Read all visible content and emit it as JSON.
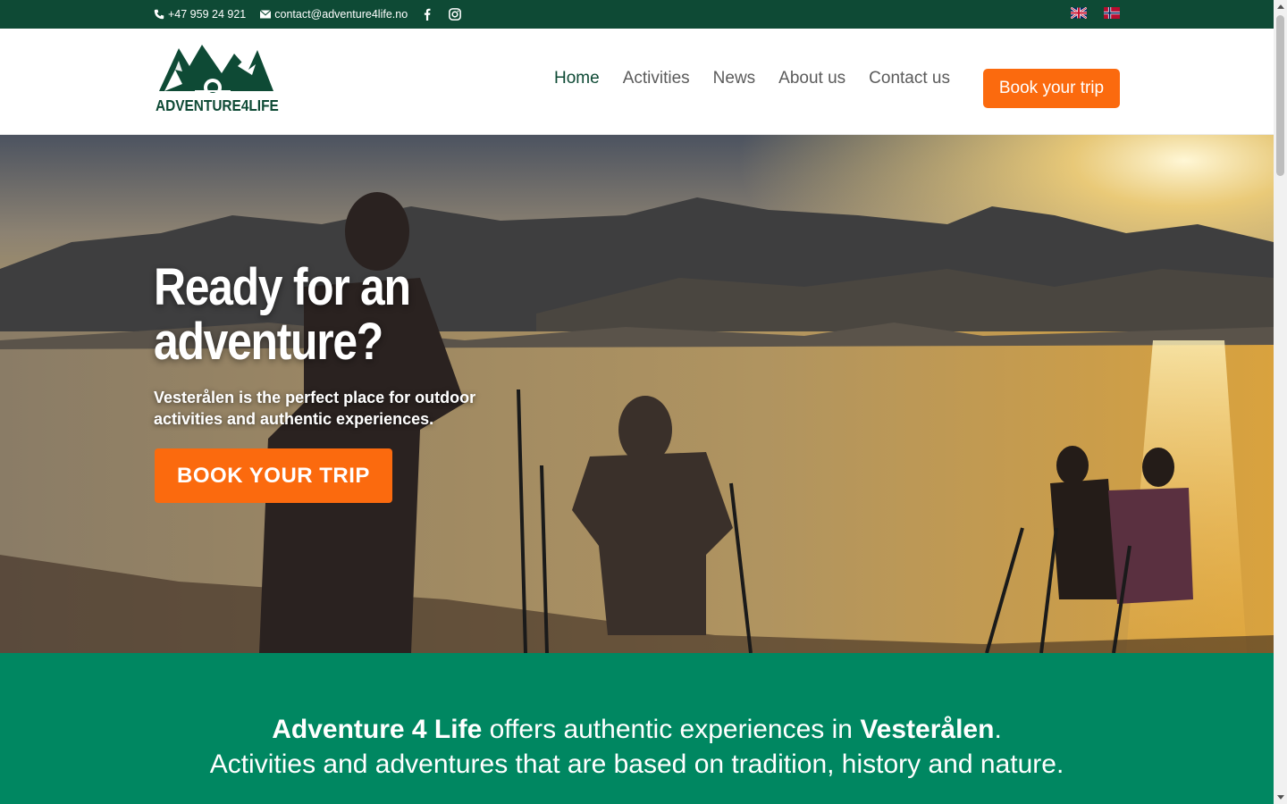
{
  "topbar": {
    "phone": "+47 959 24 921",
    "email": "contact@adventure4life.no",
    "social": [
      "facebook-icon",
      "instagram-icon"
    ],
    "languages": [
      "english-flag",
      "norwegian-flag"
    ]
  },
  "header": {
    "logo_text": "ADVENTURE4LIFE",
    "nav": [
      {
        "label": "Home",
        "active": true
      },
      {
        "label": "Activities",
        "active": false
      },
      {
        "label": "News",
        "active": false
      },
      {
        "label": "About us",
        "active": false
      },
      {
        "label": "Contact us",
        "active": false
      }
    ],
    "book_label": "Book your trip"
  },
  "hero": {
    "title": "Ready for an adventure?",
    "subtitle": "Vesterålen is the perfect place for outdoor activities and authentic experiences.",
    "cta_label": "BOOK YOUR TRIP"
  },
  "intro": {
    "brand": "Adventure 4 Life",
    "offers_text": " offers authentic experiences in ",
    "place": "Vesterålen",
    "period": ".",
    "line2": "Activities and adventures that are based on tradition, history and nature."
  },
  "colors": {
    "dark_green": "#0e4a35",
    "accent_orange": "#fb6a0e",
    "section_green": "#008761"
  }
}
